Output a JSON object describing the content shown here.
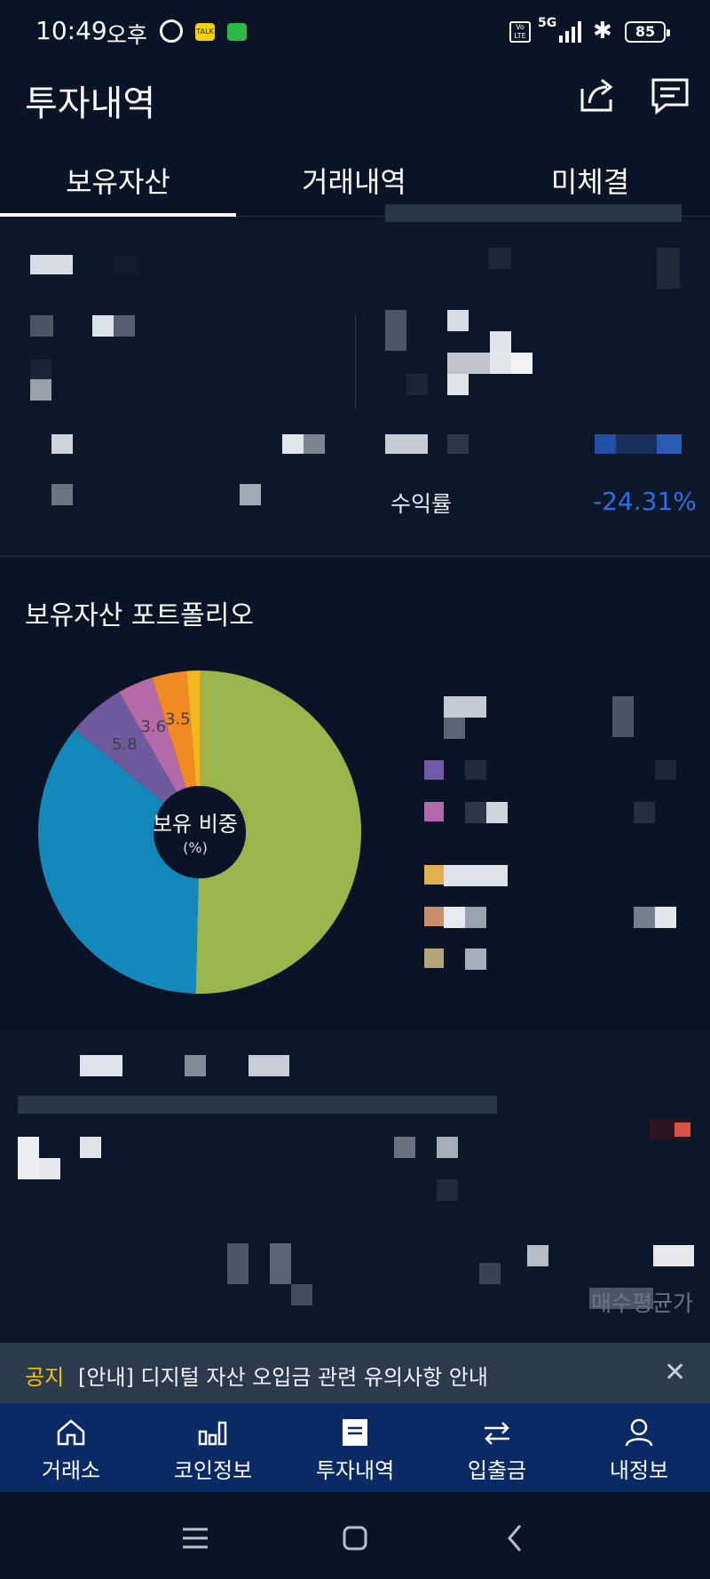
{
  "status_bar": {
    "time": "10:49",
    "ampm": "오후",
    "talk_badge": "TALK",
    "volte": "Vo LTE",
    "network": "5G",
    "battery": "85"
  },
  "header": {
    "title": "투자내역"
  },
  "tabs": [
    {
      "label": "보유자산"
    },
    {
      "label": "거래내역"
    },
    {
      "label": "미체결"
    }
  ],
  "summary": {
    "yield_label": "수익률",
    "yield_value": "-24.31%"
  },
  "portfolio": {
    "title": "보유자산 포트폴리오",
    "center_label": "보유 비중",
    "center_sub": "(%)"
  },
  "chart_data": {
    "type": "pie",
    "title": "보유자산 포트폴리오",
    "series": [
      {
        "value": 50.9,
        "color": "#9bb54c"
      },
      {
        "value": 35.9,
        "color": "#1487bb"
      },
      {
        "value": 5.8,
        "label": "5.8",
        "color": "#6e5a9c"
      },
      {
        "value": 3.6,
        "label": "3.6",
        "color": "#b56aa8"
      },
      {
        "value": 3.5,
        "label": "3.5",
        "color": "#f28a22"
      },
      {
        "value": 1.3,
        "color": "#f2b81e"
      }
    ],
    "legend_colors": [
      "#6e5aa6",
      "#b06aac",
      "#e0b050",
      "#c98f6a",
      "#b6a37a"
    ]
  },
  "lower": {
    "watermark": "매수평균가"
  },
  "notice": {
    "tag": "공지",
    "text": "[안내] 디지털 자산 오입금 관련 유의사항 안내"
  },
  "bottom_nav": [
    {
      "label": "거래소",
      "icon": "home-icon"
    },
    {
      "label": "코인정보",
      "icon": "bar-chart-icon"
    },
    {
      "label": "투자내역",
      "icon": "list-icon"
    },
    {
      "label": "입출금",
      "icon": "transfer-icon"
    },
    {
      "label": "내정보",
      "icon": "person-icon"
    }
  ]
}
